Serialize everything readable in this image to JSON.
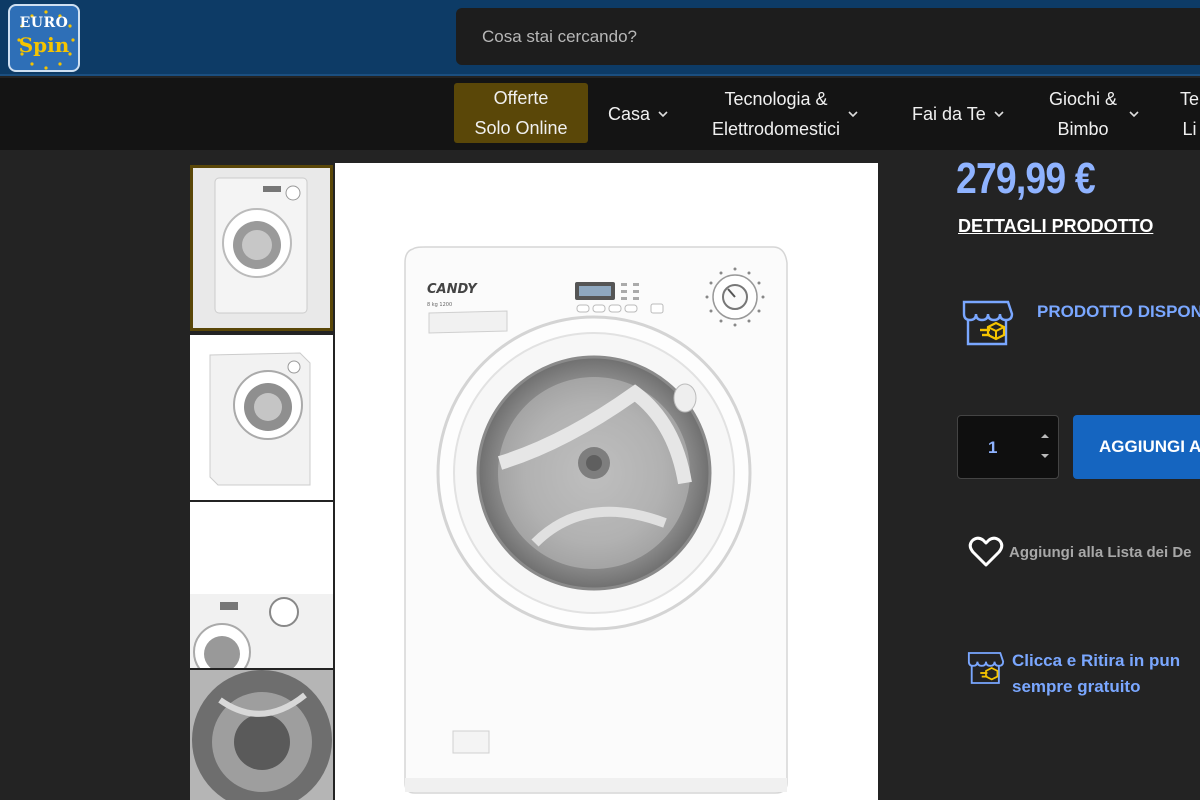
{
  "header": {
    "logo_top": "EURO",
    "logo_bottom": "Spin",
    "search_placeholder": "Cosa stai cercando?"
  },
  "nav": {
    "items": [
      {
        "label": "Offerte\nSolo Online",
        "has_dropdown": false
      },
      {
        "label": "Casa",
        "has_dropdown": true
      },
      {
        "label": "Tecnologia &\nElettrodomestici",
        "has_dropdown": true
      },
      {
        "label": "Fai da Te",
        "has_dropdown": true
      },
      {
        "label": "Giochi &\nBimbo",
        "has_dropdown": true
      },
      {
        "label": "Te\nLi",
        "has_dropdown": false
      }
    ]
  },
  "product": {
    "price": "279,99 €",
    "details_link": "DETTAGLI PRODOTTO",
    "availability": "PRODOTTO DISPON",
    "quantity": "1",
    "add_button": "AGGIUNGI A",
    "wishlist": "Aggiungi alla Lista dei De",
    "click_collect_line1": "Clicca e Ritira in pun",
    "click_collect_line2": "sempre gratuito",
    "brand_on_machine": "CANDY"
  },
  "colors": {
    "header_bg": "#0d3b66",
    "nav_bg": "#141414",
    "offerte_bg": "#5a4708",
    "accent_blue": "#8fb3ff",
    "button_blue": "#1565c0",
    "icon_yellow": "#f5c400"
  }
}
